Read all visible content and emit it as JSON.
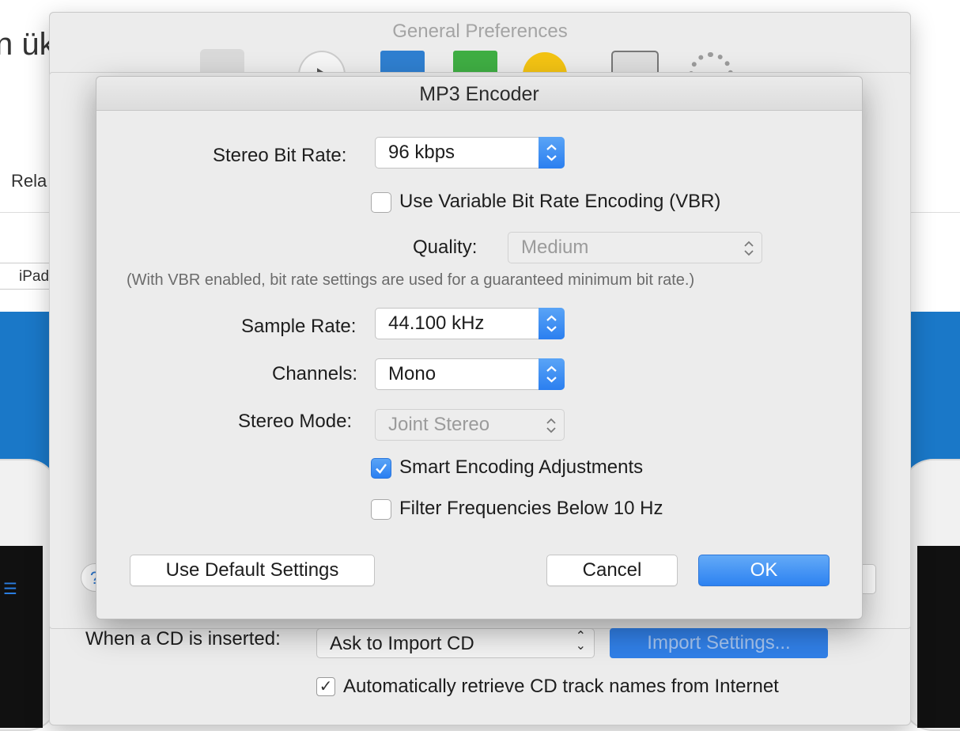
{
  "background": {
    "title_fragment": "n ük",
    "nav_fragment": "Rela",
    "pill_fragment": "iPad"
  },
  "prefs_window": {
    "title": "General Preferences",
    "toolbar_icons": [
      "general-icon",
      "playback-icon",
      "sharing-icon",
      "store-icon",
      "parental-icon",
      "devices-icon",
      "advanced-icon"
    ],
    "help_label": "?",
    "cd_inserted_label": "When a CD is inserted:",
    "cd_action_value": "Ask to Import CD",
    "import_settings_label": "Import Settings...",
    "auto_retrieve_label": "Automatically retrieve CD track names from Internet",
    "auto_retrieve_checked": true
  },
  "dialog": {
    "title": "MP3 Encoder",
    "stereo_bit_rate_label": "Stereo Bit Rate:",
    "stereo_bit_rate_value": "96 kbps",
    "vbr_label": "Use Variable Bit Rate Encoding (VBR)",
    "vbr_checked": false,
    "quality_label": "Quality:",
    "quality_value": "Medium",
    "vbr_note": "(With VBR enabled, bit rate settings are used for a guaranteed minimum bit rate.)",
    "sample_rate_label": "Sample Rate:",
    "sample_rate_value": "44.100 kHz",
    "channels_label": "Channels:",
    "channels_value": "Mono",
    "stereo_mode_label": "Stereo Mode:",
    "stereo_mode_value": "Joint Stereo",
    "smart_encoding_label": "Smart Encoding Adjustments",
    "smart_encoding_checked": true,
    "filter_label": "Filter Frequencies Below 10 Hz",
    "filter_checked": false,
    "default_button": "Use Default Settings",
    "cancel_button": "Cancel",
    "ok_button": "OK"
  },
  "colors": {
    "accent_blue": "#2d82f1",
    "window_bg": "#ececec",
    "background_blue": "#1a78c8"
  }
}
